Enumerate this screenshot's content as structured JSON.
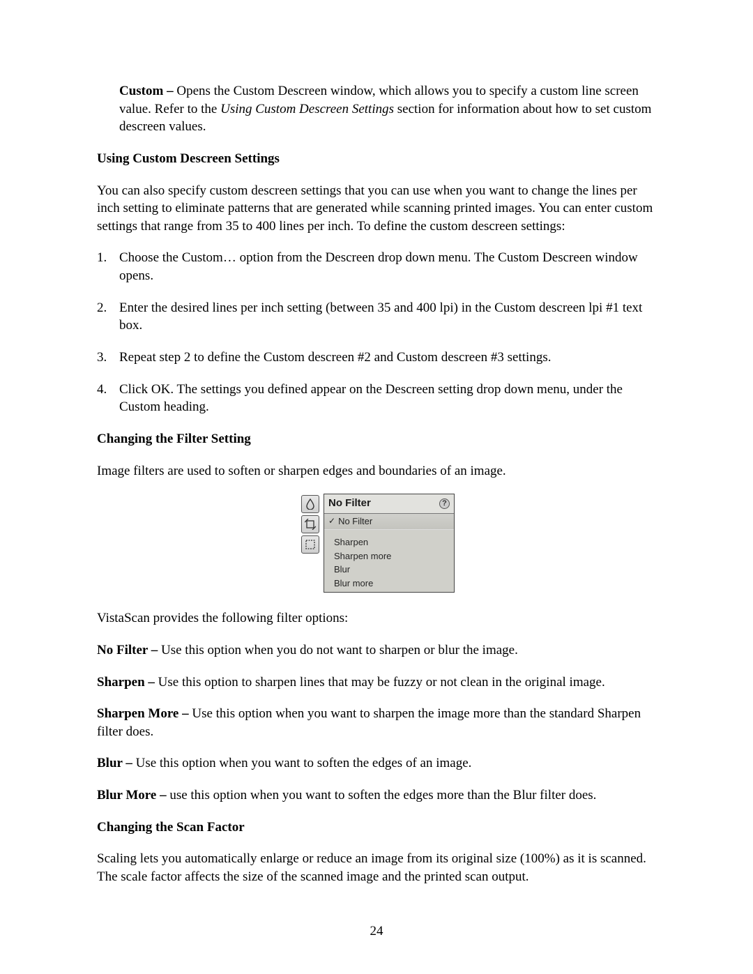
{
  "custom_section": {
    "label": "Custom –",
    "text_part1": " Opens the Custom Descreen window, which allows you to specify a custom line screen value.  Refer to the ",
    "italic": "Using Custom Descreen Settings",
    "text_part2": " section for information about how to set custom descreen values."
  },
  "heading1": "Using Custom Descreen Settings",
  "para1": "You can also specify custom descreen settings that you can use when you want to change the lines per inch setting to eliminate patterns that are generated while scanning printed images.  You can enter custom settings that range from 35 to 400 lines per inch.  To define the custom descreen settings:",
  "steps": [
    "Choose the Custom… option from the Descreen drop down menu.  The Custom Descreen window opens.",
    "Enter the desired lines per inch setting (between 35 and 400 lpi) in the Custom descreen lpi #1 text box.",
    "Repeat step 2 to define the Custom descreen #2 and Custom descreen #3 settings.",
    "Click OK.  The settings you defined appear on the Descreen setting drop down menu, under the Custom heading."
  ],
  "heading2": "Changing the Filter Setting",
  "para2": "Image filters are used to soften or sharpen edges and boundaries of an image.",
  "ui": {
    "icons": [
      "droplet-icon",
      "crop-icon",
      "selection-icon"
    ],
    "header": "No Filter",
    "help_glyph": "?",
    "selected": "No Filter",
    "items": [
      "Sharpen",
      "Sharpen more",
      "Blur",
      "Blur more"
    ]
  },
  "para3": "VistaScan provides the following filter options:",
  "filters": {
    "no_filter": {
      "label": "No Filter –",
      "text": " Use this option when you do not want to sharpen or blur the image."
    },
    "sharpen": {
      "label": "Sharpen –",
      "text": " Use this option to sharpen lines that may be fuzzy or not clean in the original image."
    },
    "sharpen_more": {
      "label": "Sharpen More –",
      "text": " Use this option when you want to sharpen the image more than the standard Sharpen filter does."
    },
    "blur": {
      "label": "Blur –",
      "text": " Use this option when you want to soften the edges of an image."
    },
    "blur_more": {
      "label": "Blur More –",
      "text": " use this option when you want to soften the edges more than the Blur filter does."
    }
  },
  "heading3": "Changing the Scan Factor",
  "para4": "Scaling lets you automatically enlarge or reduce an image from its original size (100%) as it is scanned.  The scale factor affects the size of the scanned image and the printed scan output.",
  "page_number": "24"
}
